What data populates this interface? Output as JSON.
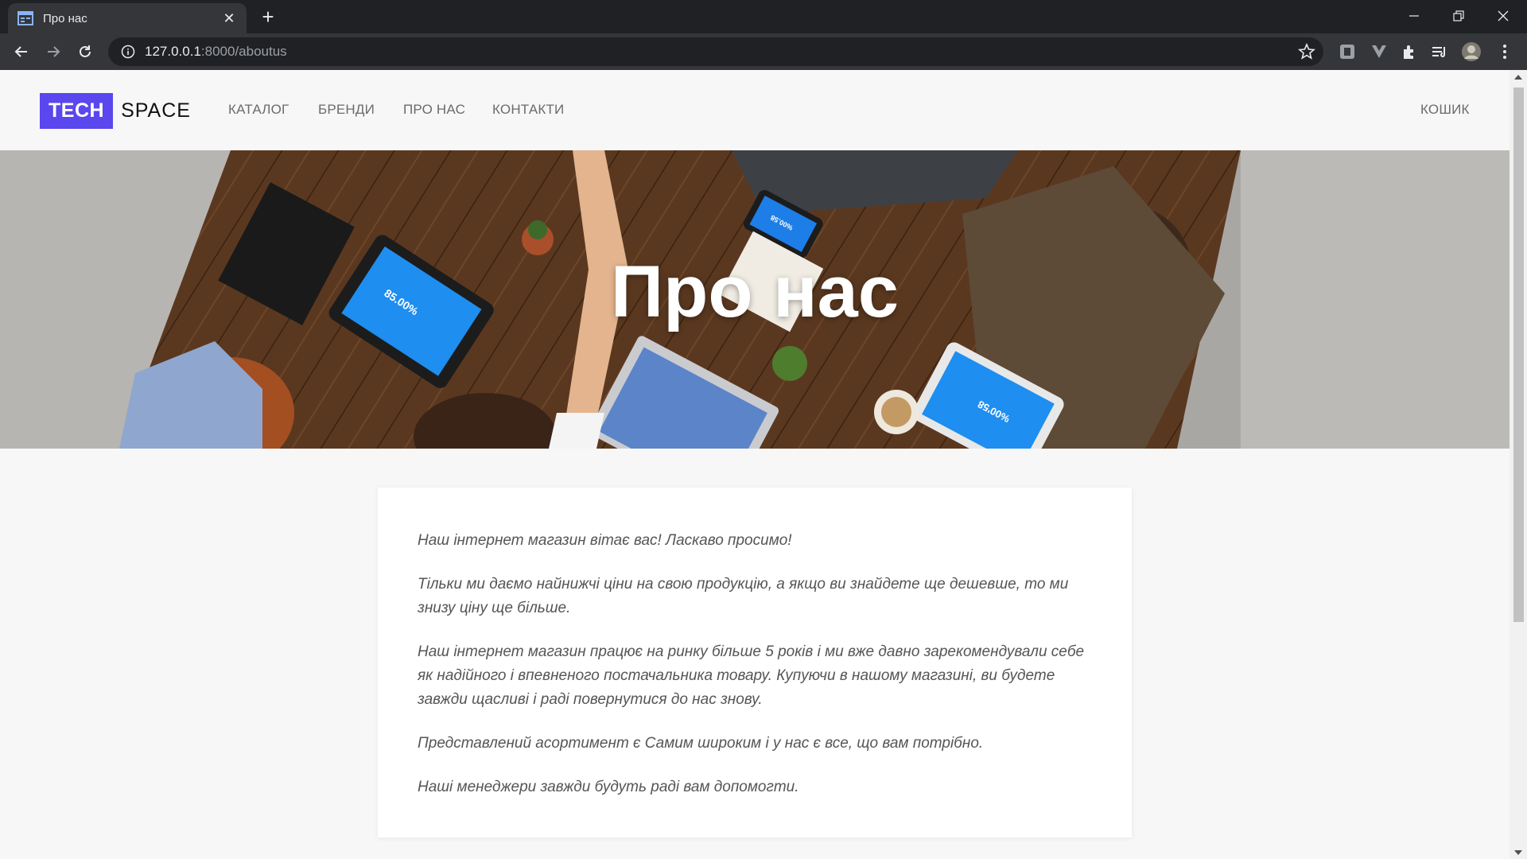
{
  "browser": {
    "tab_title": "Про нас",
    "new_tab_label": "+",
    "url_host": "127.0.0.1",
    "url_path": ":8000/aboutus"
  },
  "site": {
    "logo_tech": "TECH",
    "logo_space": "SPACE",
    "nav": [
      {
        "label": "КАТАЛОГ"
      },
      {
        "label": "БРЕНДИ"
      },
      {
        "label": "ПРО НАС"
      },
      {
        "label": "КОНТАКТИ"
      }
    ],
    "cart_label": "КОШИК",
    "accent_color": "#5a47ee"
  },
  "hero": {
    "title": "Про нас",
    "screen_texts": [
      "85.00%",
      "%00.58",
      "%00'58"
    ]
  },
  "content": {
    "paragraphs": [
      "Наш інтернет магазин вітає вас! Ласкаво просимо!",
      "Тільки ми даємо найнижчі ціни на свою продукцію, а якщо ви знайдете ще дешевше, то ми знизу ціну ще більше.",
      "Наш інтернет магазин працює на ринку більше 5 років і ми вже давно зарекомендували себе як надійного і впевненого постачальника товару. Купуючи в нашому магазині, ви будете завжди щасливі і раді повернутися до нас знову.",
      "Представлений асортимент є Самим широким і у нас є все, що вам потрібно.",
      "Наші менеджери завжди будуть раді вам допомогти."
    ]
  }
}
